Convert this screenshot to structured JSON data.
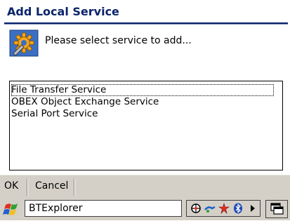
{
  "dialog": {
    "title": "Add Local Service",
    "prompt": "Please select service to add...",
    "icon": "service-gear-icon"
  },
  "services": [
    {
      "label": "File Transfer Service",
      "selected": true
    },
    {
      "label": "OBEX Object Exchange Service",
      "selected": false
    },
    {
      "label": "Serial Port Service",
      "selected": false
    }
  ],
  "menubar": {
    "ok_label": "OK",
    "cancel_label": "Cancel"
  },
  "taskbar": {
    "active_app": "BTExplorer",
    "tray_icons": [
      "network-icon",
      "connection-icon",
      "bluetooth-star-icon",
      "bluetooth-icon",
      "arrow-right-icon"
    ],
    "window-switch-icon": "windows-icon"
  },
  "colors": {
    "title_text": "#0a246a",
    "bar_bg": "#d4d0c8"
  }
}
